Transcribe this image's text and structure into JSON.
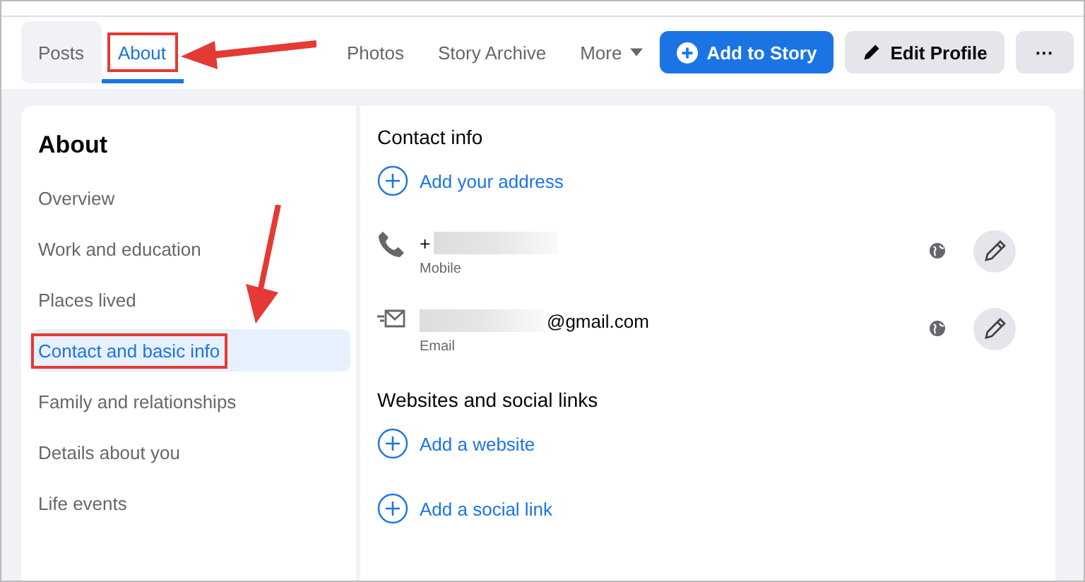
{
  "tabs": [
    {
      "label": "Posts",
      "selected": false,
      "hovered": true,
      "callout": false,
      "dropdown": false
    },
    {
      "label": "About",
      "selected": true,
      "hovered": false,
      "callout": true,
      "dropdown": false
    },
    {
      "label": "Photos",
      "selected": false,
      "hovered": false,
      "callout": false,
      "dropdown": false
    },
    {
      "label": "Story Archive",
      "selected": false,
      "hovered": false,
      "callout": false,
      "dropdown": false
    },
    {
      "label": "More",
      "selected": false,
      "hovered": false,
      "callout": false,
      "dropdown": true
    }
  ],
  "actions": [
    {
      "kind": "primary",
      "label": "Add to Story"
    },
    {
      "kind": "secondary",
      "label": "Edit Profile"
    },
    {
      "kind": "more",
      "label": "···"
    }
  ],
  "sidebar": {
    "title": "About",
    "items": [
      {
        "label": "Overview",
        "selected": false,
        "callout": false
      },
      {
        "label": "Work and education",
        "selected": false,
        "callout": false
      },
      {
        "label": "Places lived",
        "selected": false,
        "callout": false
      },
      {
        "label": "Contact and basic info",
        "selected": true,
        "callout": true
      },
      {
        "label": "Family and relationships",
        "selected": false,
        "callout": false
      },
      {
        "label": "Details about you",
        "selected": false,
        "callout": false
      },
      {
        "label": "Life events",
        "selected": false,
        "callout": false
      }
    ]
  },
  "sections": [
    {
      "title": "Contact info",
      "entries": [
        {
          "kind": "add",
          "label": "Add your address"
        },
        {
          "kind": "phone",
          "value": "+",
          "redacted": true,
          "redacted_after": true,
          "caption": "Mobile"
        },
        {
          "kind": "email",
          "value": "@gmail.com",
          "redacted": true,
          "redacted_after": false,
          "caption": "Email"
        }
      ]
    },
    {
      "title": "Websites and social links",
      "entries": [
        {
          "kind": "add",
          "label": "Add a website"
        },
        {
          "kind": "add",
          "label": "Add a social link"
        }
      ]
    }
  ]
}
